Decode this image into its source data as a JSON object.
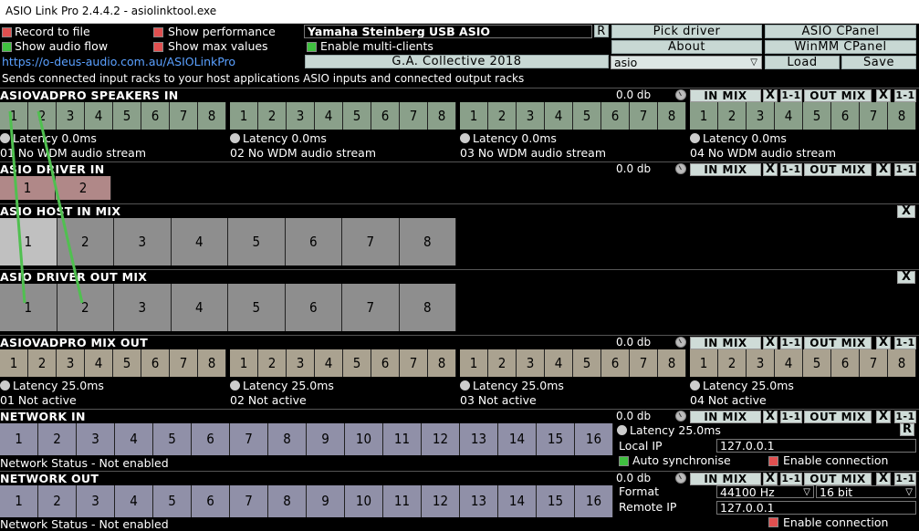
{
  "window": {
    "title": "ASIO Link Pro 2.4.4.2 - asiolinktool.exe"
  },
  "options": {
    "record_to_file": "Record to file",
    "show_audio_flow": "Show audio flow",
    "show_performance": "Show performance",
    "show_max_values": "Show max values",
    "enable_multi_clients": "Enable multi-clients",
    "url": "https://o-deus-audio.com.au/ASIOLinkPro",
    "description": "Sends connected input racks to your host applications ASIO inputs and connected output racks"
  },
  "driver": {
    "name": "Yamaha Steinberg USB ASIO",
    "r_label": "R",
    "pick_driver": "Pick driver",
    "asio_cpanel": "ASIO CPanel",
    "about": "About",
    "winmm_cpanel": "WinMM CPanel",
    "collective": "G.A. Collective 2018",
    "preset": "asio",
    "load": "Load",
    "save": "Save"
  },
  "common": {
    "db": "0.0 db",
    "in_mix": "IN MIX",
    "out_mix": "OUT MIX",
    "close": "X",
    "one_one": "1-1"
  },
  "speakers_in": {
    "title": "ASIOVADPRO SPEAKERS IN",
    "channels": [
      "1",
      "2",
      "3",
      "4",
      "5",
      "6",
      "7",
      "8"
    ],
    "racks": [
      {
        "latency": "Latency 0.0ms",
        "status": "01 No WDM audio stream"
      },
      {
        "latency": "Latency 0.0ms",
        "status": "02 No WDM audio stream"
      },
      {
        "latency": "Latency 0.0ms",
        "status": "03 No WDM audio stream"
      },
      {
        "latency": "Latency 0.0ms",
        "status": "04 No WDM audio stream"
      }
    ]
  },
  "driver_in": {
    "title": "ASIO DRIVER IN",
    "channels": [
      "1",
      "2"
    ]
  },
  "host_in_mix": {
    "title": "ASIO HOST IN MIX",
    "channels": [
      "1",
      "2",
      "3",
      "4",
      "5",
      "6",
      "7",
      "8"
    ]
  },
  "driver_out_mix": {
    "title": "ASIO DRIVER OUT MIX",
    "channels": [
      "1",
      "2",
      "3",
      "4",
      "5",
      "6",
      "7",
      "8"
    ]
  },
  "mix_out": {
    "title": "ASIOVADPRO MIX OUT",
    "channels": [
      "1",
      "2",
      "3",
      "4",
      "5",
      "6",
      "7",
      "8"
    ],
    "racks": [
      {
        "latency": "Latency 25.0ms",
        "status": "01 Not active"
      },
      {
        "latency": "Latency 25.0ms",
        "status": "02 Not active"
      },
      {
        "latency": "Latency 25.0ms",
        "status": "03 Not active"
      },
      {
        "latency": "Latency 25.0ms",
        "status": "04 Not active"
      }
    ]
  },
  "network_in": {
    "title": "NETWORK IN",
    "channels": [
      "1",
      "2",
      "3",
      "4",
      "5",
      "6",
      "7",
      "8",
      "9",
      "10",
      "11",
      "12",
      "13",
      "14",
      "15",
      "16"
    ],
    "status": "Network Status - Not enabled",
    "latency": "Latency 25.0ms",
    "local_ip_label": "Local IP",
    "local_ip": "127.0.0.1",
    "auto_sync": "Auto synchronise",
    "enable_connection": "Enable connection"
  },
  "network_out": {
    "title": "NETWORK OUT",
    "channels": [
      "1",
      "2",
      "3",
      "4",
      "5",
      "6",
      "7",
      "8",
      "9",
      "10",
      "11",
      "12",
      "13",
      "14",
      "15",
      "16"
    ],
    "status": "Network Status - Not enabled",
    "format_label": "Format",
    "format": "44100 Hz",
    "bits": "16 bit",
    "remote_ip_label": "Remote IP",
    "remote_ip": "127.0.0.1",
    "enable_connection": "Enable connection"
  },
  "colors": {
    "speakers": "#8aa08a",
    "driver_in": "#b08888",
    "host_mix": "#8e8e8e",
    "mix_out": "#aaa290",
    "network": "#9090a8",
    "flow_line": "#50c050"
  }
}
